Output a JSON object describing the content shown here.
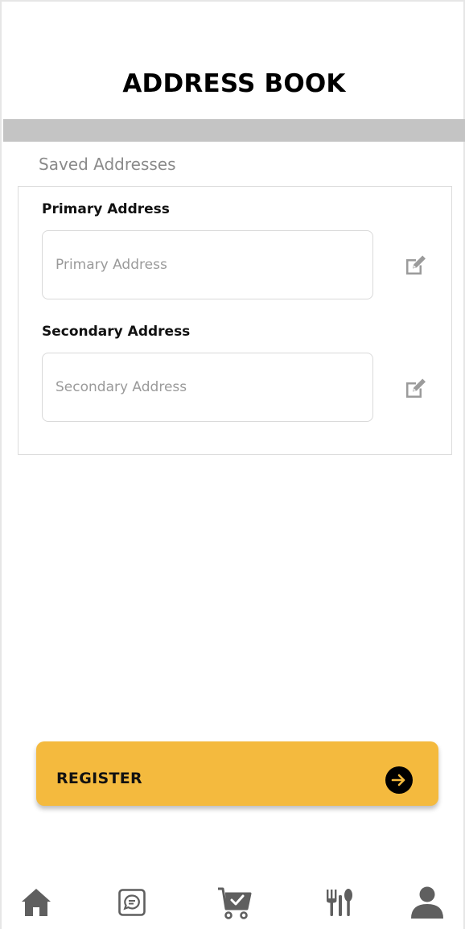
{
  "header": {
    "title": "ADDRESS BOOK"
  },
  "saved": {
    "section_label": "Saved Addresses",
    "primary": {
      "label": "Primary Address",
      "placeholder": "Primary Address",
      "value": "",
      "edit_icon": "edit-icon"
    },
    "secondary": {
      "label": "Secondary Address",
      "placeholder": "Secondary Address",
      "value": "",
      "edit_icon": "edit-icon"
    }
  },
  "register": {
    "label": "REGISTER",
    "icon": "arrow-right-circle-icon",
    "color": "#f4ba3e"
  },
  "nav": {
    "items": [
      {
        "icon": "home-icon"
      },
      {
        "icon": "chat-icon"
      },
      {
        "icon": "cart-check-icon"
      },
      {
        "icon": "restaurant-icon"
      },
      {
        "icon": "profile-icon"
      }
    ],
    "icon_color": "#5f5f5f"
  },
  "colors": {
    "header_bar": "#c4c4c4",
    "accent": "#f4ba3e",
    "muted_text": "#8a8a8a"
  }
}
